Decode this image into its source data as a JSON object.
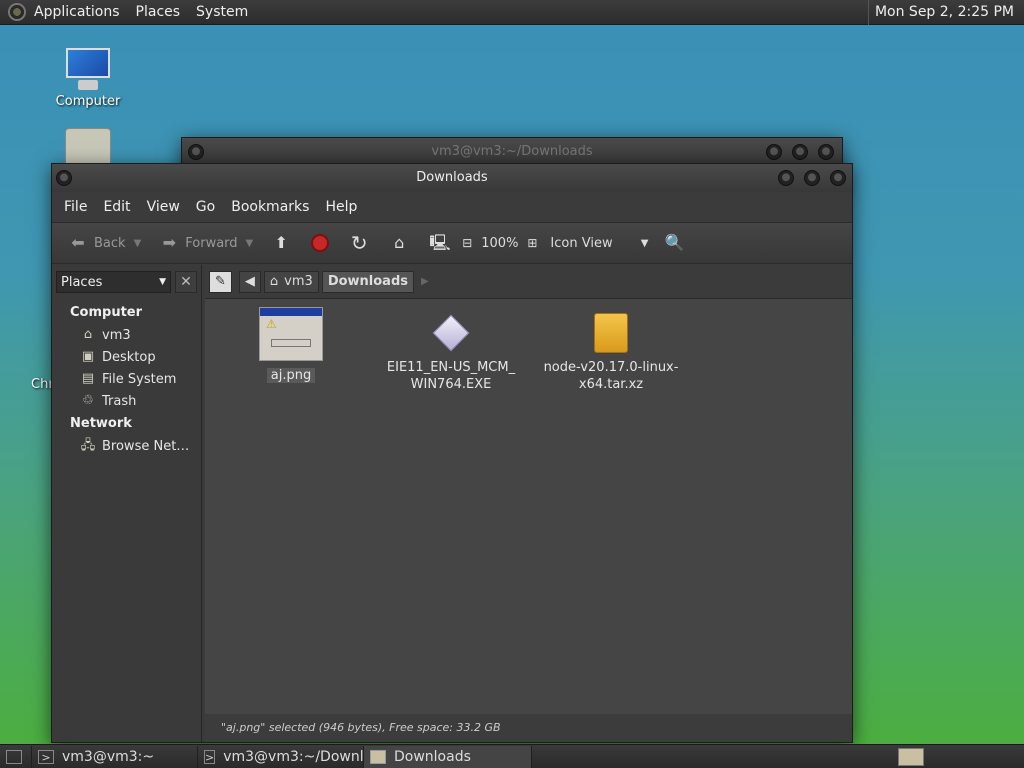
{
  "top_panel": {
    "menus": [
      "Applications",
      "Places",
      "System"
    ],
    "clock": "Mon Sep  2,  2:25 PM"
  },
  "desktop": {
    "icons": [
      {
        "label": "Computer",
        "icon": "computer-icon"
      },
      {
        "label": "",
        "icon": "home-folder-icon"
      }
    ],
    "partial_label": "Chr"
  },
  "back_window": {
    "title": "vm3@vm3:~/Downloads"
  },
  "file_manager": {
    "title": "Downloads",
    "menu": [
      "File",
      "Edit",
      "View",
      "Go",
      "Bookmarks",
      "Help"
    ],
    "toolbar": {
      "back": "Back",
      "forward": "Forward",
      "zoom": "100%",
      "view_mode": "Icon View"
    },
    "sidebar": {
      "selector": "Places",
      "sections": [
        {
          "heading": "Computer",
          "items": [
            {
              "label": "vm3",
              "icon": "home-icon"
            },
            {
              "label": "Desktop",
              "icon": "desktop-icon"
            },
            {
              "label": "File System",
              "icon": "drive-icon"
            },
            {
              "label": "Trash",
              "icon": "trash-icon"
            }
          ]
        },
        {
          "heading": "Network",
          "items": [
            {
              "label": "Browse Net…",
              "icon": "network-icon"
            }
          ]
        }
      ]
    },
    "location": {
      "crumbs": [
        "vm3",
        "Downloads"
      ]
    },
    "files": [
      {
        "name": "aj.png",
        "type": "image"
      },
      {
        "name": "EIE11_EN-US_MCM_\nWIN764.EXE",
        "line1": "EIE11_EN-US_MCM_",
        "line2": "WIN764.EXE",
        "type": "exe"
      },
      {
        "name": "node-v20.17.0-linux-x64.tar.xz",
        "line1": "node-v20.17.0-linux-",
        "line2": "x64.tar.xz",
        "type": "archive"
      }
    ],
    "status": "\"aj.png\" selected (946 bytes), Free space: 33.2 GB"
  },
  "taskbar": {
    "tasks": [
      "vm3@vm3:~",
      "vm3@vm3:~/Downl…",
      "Downloads"
    ]
  }
}
